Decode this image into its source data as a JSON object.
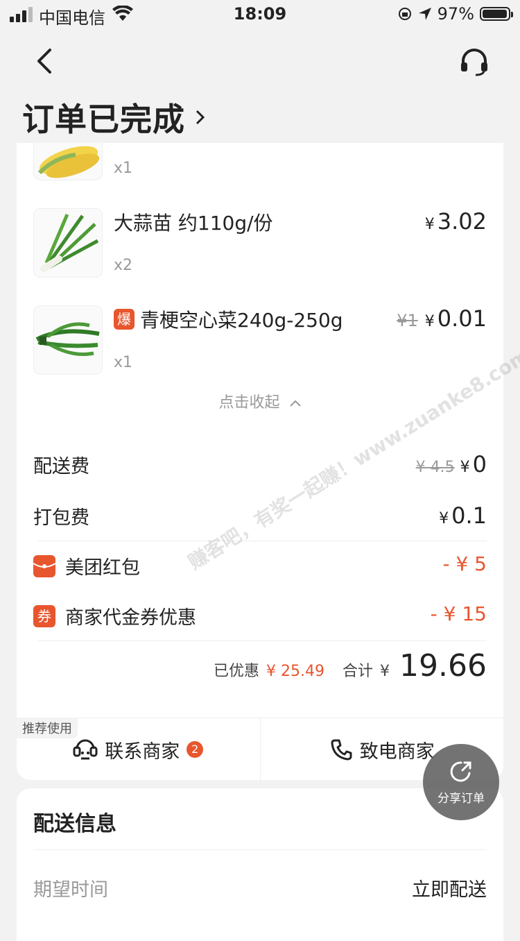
{
  "status_bar": {
    "carrier": "中国电信",
    "time": "18:09",
    "battery_percent": "97%",
    "battery_level": 0.97
  },
  "nav": {
    "title": "订单已完成",
    "back_icon": "chevron-left-icon",
    "service_icon": "headset-icon"
  },
  "items": [
    {
      "name": "",
      "qty": "x1",
      "price": "",
      "thumb": "corn"
    },
    {
      "name": "大蒜苗 约110g/份",
      "qty": "x2",
      "price": "3.02",
      "thumb": "garlic-sprout"
    },
    {
      "name": "青梗空心菜240g-250g",
      "tag": "爆",
      "qty": "x1",
      "original_price": "¥1",
      "price": "0.01",
      "thumb": "water-spinach"
    }
  ],
  "collapse_label": "点击收起",
  "currency": "¥",
  "fees": {
    "delivery": {
      "label": "配送费",
      "original": "¥ 4.5",
      "value": "0"
    },
    "packing": {
      "label": "打包费",
      "value": "0.1"
    }
  },
  "discounts": {
    "meituan_redpacket": {
      "label": "美团红包",
      "value": "- ¥ 5"
    },
    "merchant_voucher": {
      "label": "商家代金券优惠",
      "icon_text": "券",
      "value": "- ¥ 15"
    }
  },
  "summary": {
    "saved_label": "已优惠",
    "saved_value": "¥ 25.49",
    "total_label": "合计",
    "total_value": "19.66"
  },
  "actions": {
    "recommend_tag": "推荐使用",
    "contact_merchant": "联系商家",
    "contact_badge": "2",
    "call_merchant": "致电商家"
  },
  "share": {
    "label": "分享订单"
  },
  "delivery_info": {
    "title": "配送信息",
    "expected_time_label": "期望时间",
    "expected_time_value": "立即配送"
  },
  "watermark": "赚客吧，有奖一起赚！www.zuanke8.com",
  "colors": {
    "accent": "#e8562e",
    "background": "#f2f2f2"
  }
}
